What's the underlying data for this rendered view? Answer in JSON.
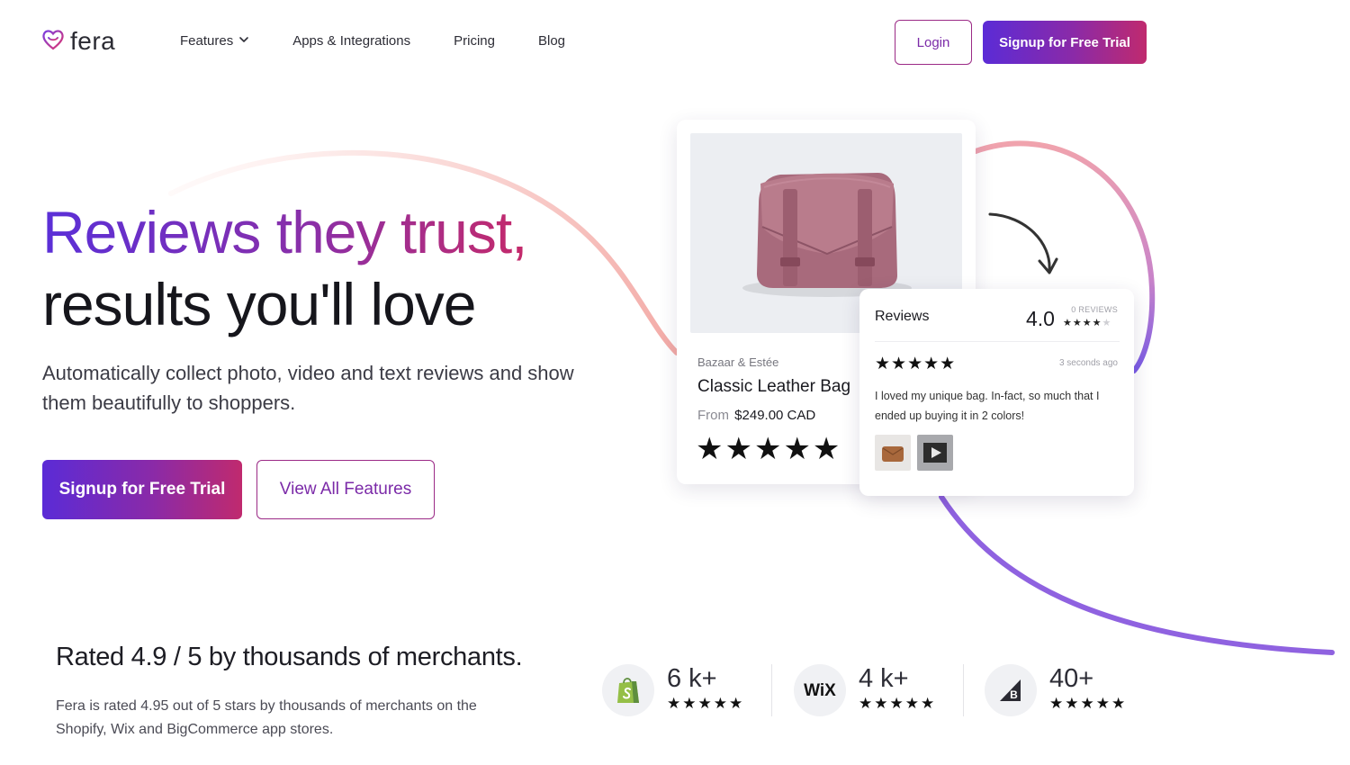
{
  "brand": {
    "name": "fera"
  },
  "nav": {
    "links": [
      {
        "label": "Features"
      },
      {
        "label": "Apps & Integrations"
      },
      {
        "label": "Pricing"
      },
      {
        "label": "Blog"
      }
    ],
    "login_label": "Login",
    "signup_label": "Signup for Free Trial"
  },
  "hero": {
    "title_line1": "Reviews they trust,",
    "title_line2": "results you'll love",
    "subtitle": "Automatically collect photo, video and text reviews and show them beautifully to shoppers.",
    "primary_cta": "Signup for Free Trial",
    "secondary_cta": "View All Features"
  },
  "product_card": {
    "brand": "Bazaar & Estée",
    "name": "Classic Leather Bag",
    "price_prefix": "From",
    "price": "$249.00 CAD",
    "rating_stars": "★★★★★"
  },
  "reviews_card": {
    "title": "Reviews",
    "score": "4.0",
    "count_label": "0 REVIEWS",
    "review_stars": "★★★★★",
    "time": "3 seconds ago",
    "review_text": "I loved my unique bag. In-fact, so much that I ended up buying it in 2 colors!"
  },
  "rating_strip": {
    "title": "Rated 4.9 / 5 by thousands of merchants.",
    "subtitle": "Fera is rated 4.95 out of 5 stars by thousands of merchants on the Shopify, Wix and BigCommerce app stores.",
    "platforms": [
      {
        "icon": "shopify-icon",
        "count": "6 k+",
        "stars": "★★★★★"
      },
      {
        "icon": "wix-icon",
        "count": "4 k+",
        "stars": "★★★★★"
      },
      {
        "icon": "bigcommerce-icon",
        "count": "40+",
        "stars": "★★★★★"
      }
    ]
  },
  "colors": {
    "gradient_start": "#5b2bd6",
    "gradient_mid": "#8a2aa8",
    "gradient_end": "#c02a6e",
    "accent_outline": "#9b2a86"
  }
}
